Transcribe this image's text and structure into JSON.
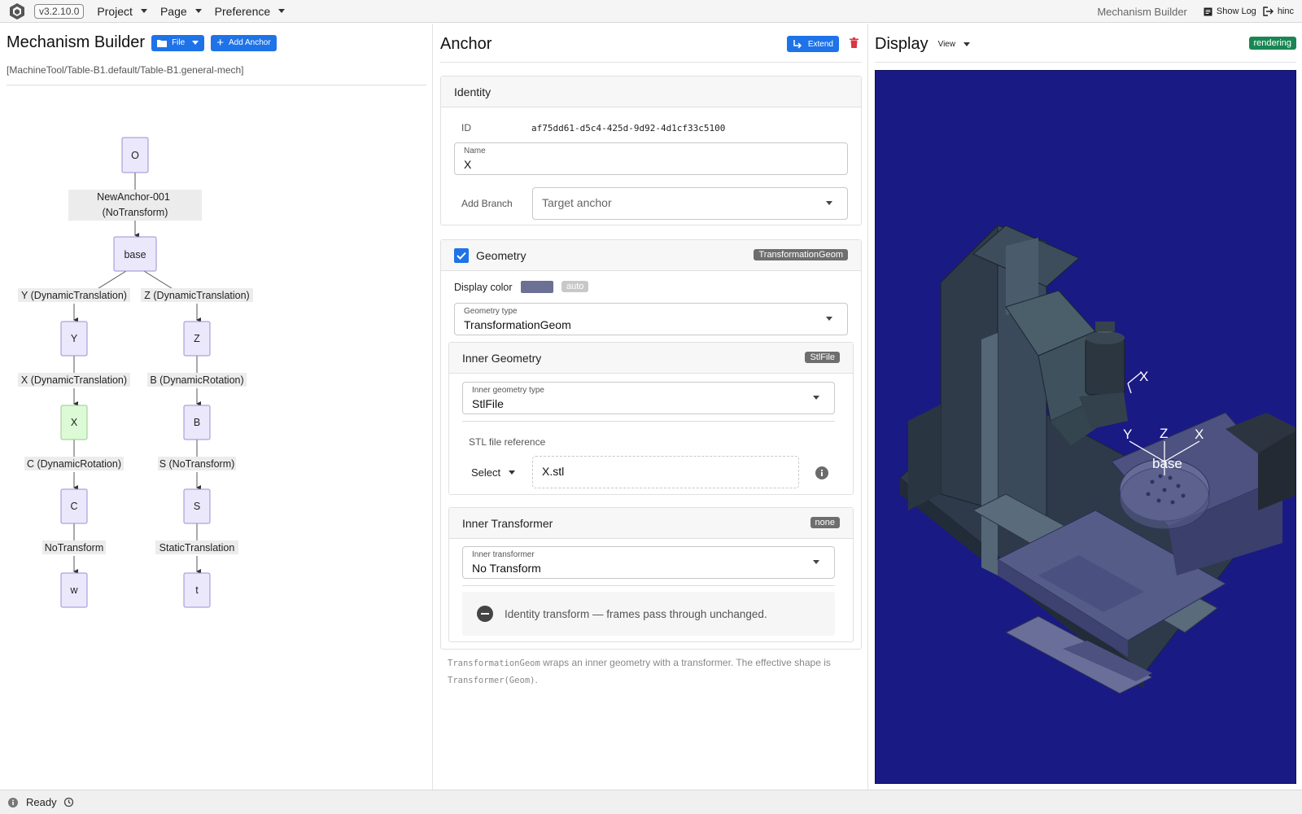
{
  "topbar": {
    "version": "v3.2.10.0",
    "menus": [
      {
        "label": "Project"
      },
      {
        "label": "Page"
      },
      {
        "label": "Preference"
      }
    ],
    "app_name": "Mechanism Builder",
    "show_log": "Show Log",
    "user": "hinc"
  },
  "left": {
    "title": "Mechanism Builder",
    "file_button": "File",
    "add_anchor_button": "Add Anchor",
    "breadcrumb": "[MachineTool/Table-B1.default/Table-B1.general-mech]"
  },
  "tree": {
    "nodes": {
      "root": "O",
      "base": "base",
      "y": "Y",
      "z": "Z",
      "x": "X",
      "b": "B",
      "c": "C",
      "s": "S",
      "w": "w",
      "t": "t"
    },
    "edges": {
      "root_base_1": "NewAnchor-001",
      "root_base_2": "(NoTransform)",
      "base_y": "Y (DynamicTranslation)",
      "base_z": "Z (DynamicTranslation)",
      "y_x": "X (DynamicTranslation)",
      "z_b": "B (DynamicRotation)",
      "x_c": "C (DynamicRotation)",
      "b_s": "S (NoTransform)",
      "c_w": "NoTransform",
      "s_t": "StaticTranslation"
    }
  },
  "anchor": {
    "title": "Anchor",
    "extend_button": "Extend",
    "identity": {
      "header": "Identity",
      "id_label": "ID",
      "id_value": "af75dd61-d5c4-425d-9d92-4d1cf33c5100",
      "name_label": "Name",
      "name_value": "X",
      "add_branch_label": "Add Branch",
      "target_anchor_placeholder": "Target anchor"
    },
    "geometry": {
      "header": "Geometry",
      "badge": "TransformationGeom",
      "display_color_label": "Display color",
      "display_color": "#6b7094",
      "auto_badge": "auto",
      "geometry_type_label": "Geometry type",
      "geometry_type_value": "TransformationGeom",
      "inner_geometry": {
        "header": "Inner Geometry",
        "badge": "StlFile",
        "type_label": "Inner geometry type",
        "type_value": "StlFile",
        "stl_ref_label": "STL file reference",
        "select_label": "Select",
        "file_value": "X.stl"
      },
      "inner_transformer": {
        "header": "Inner Transformer",
        "badge": "none",
        "type_label": "Inner transformer",
        "type_value": "No Transform",
        "identity_note": "Identity transform — frames pass through unchanged."
      }
    },
    "footnote": {
      "code1": "TransformationGeom",
      "text1": " wraps an inner geometry with a transformer. The effective shape is ",
      "code2": "Transformer(Geom)",
      "text2": "."
    }
  },
  "display": {
    "title": "Display",
    "view_menu": "View",
    "status_badge": "rendering",
    "axis_labels": {
      "x_tool": "X",
      "y": "Y",
      "z": "Z",
      "x": "X",
      "base": "base"
    },
    "bg_color": "#1a1a85"
  },
  "statusbar": {
    "text": "Ready"
  }
}
